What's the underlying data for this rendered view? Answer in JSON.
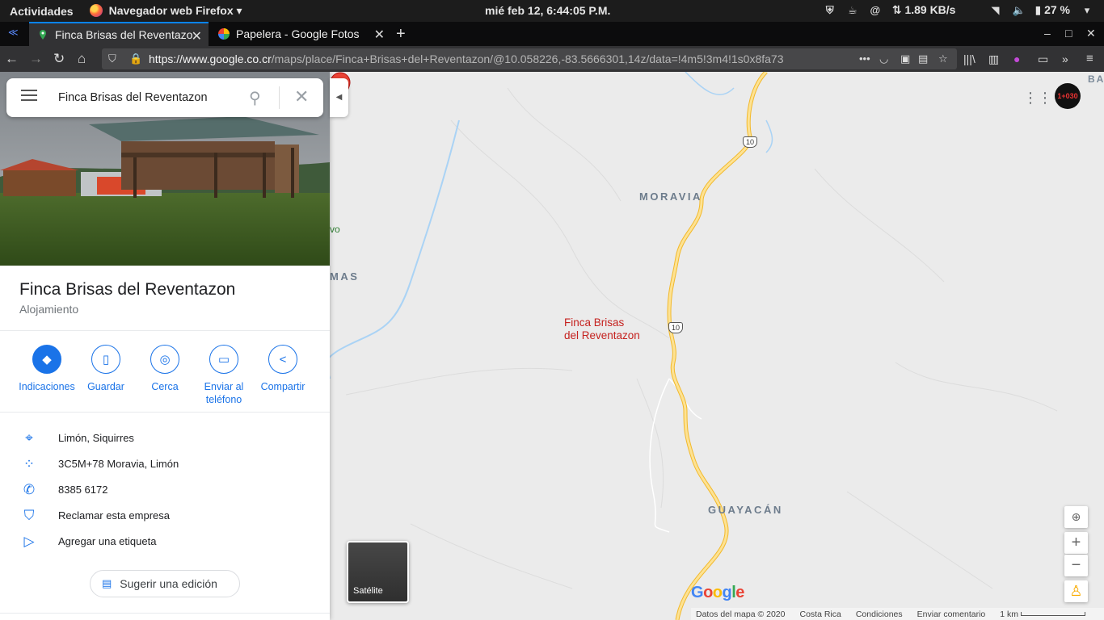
{
  "system": {
    "activities": "Actividades",
    "app_name": "Navegador web Firefox",
    "clock": "mié feb 12,  6:44:05 P.M.",
    "net_speed": "1.89 KB/s",
    "battery": "27 %"
  },
  "browser": {
    "tabs": [
      {
        "title": "Finca Brisas del Reventazon",
        "active": true
      },
      {
        "title": "Papelera - Google Fotos",
        "active": false
      }
    ],
    "url_prefix": "https://www.google.co.cr",
    "url_rest": "/maps/place/Finca+Brisas+del+Reventazon/@10.058226,-83.5666301,14z/data=!4m5!3m4!1s0x8fa73"
  },
  "search": {
    "query": "Finca Brisas del Reventazon"
  },
  "place": {
    "name": "Finca Brisas del Reventazon",
    "category": "Alojamiento",
    "actions": [
      {
        "label": "Indicaciones",
        "icon": "directions-icon"
      },
      {
        "label": "Guardar",
        "icon": "bookmark-icon"
      },
      {
        "label": "Cerca",
        "icon": "nearby-icon"
      },
      {
        "label": "Enviar al teléfono",
        "icon": "send-to-phone-icon"
      },
      {
        "label": "Compartir",
        "icon": "share-icon"
      }
    ],
    "info": [
      {
        "icon": "location-pin-icon",
        "text": "Limón, Siquirres"
      },
      {
        "icon": "plus-code-icon",
        "text": "3C5M+78 Moravia, Limón"
      },
      {
        "icon": "phone-icon",
        "text": "8385 6172"
      },
      {
        "icon": "verified-shield-icon",
        "text": "Reclamar esta empresa"
      },
      {
        "icon": "label-icon",
        "text": "Agregar una etiqueta"
      }
    ],
    "suggest_edit": "Sugerir una edición"
  },
  "map": {
    "labels": {
      "moravia": "MORAVIA",
      "guayacan": "GUAYACÁN",
      "mas": "MAS",
      "vo": "vo",
      "ba": "BA"
    },
    "route_number": "10",
    "pin_label_line1": "Finca Brisas",
    "pin_label_line2": "del Reventazon",
    "satellite_label": "Satélite",
    "avatar_text": "1+030",
    "footer": {
      "map_data": "Datos del mapa © 2020",
      "country": "Costa Rica",
      "terms": "Condiciones",
      "feedback": "Enviar comentario",
      "scale": "1 km"
    },
    "colors": {
      "road": "#f7d25a",
      "river": "#aad3f5",
      "pin": "#ea4335",
      "accent": "#1a73e8"
    }
  }
}
